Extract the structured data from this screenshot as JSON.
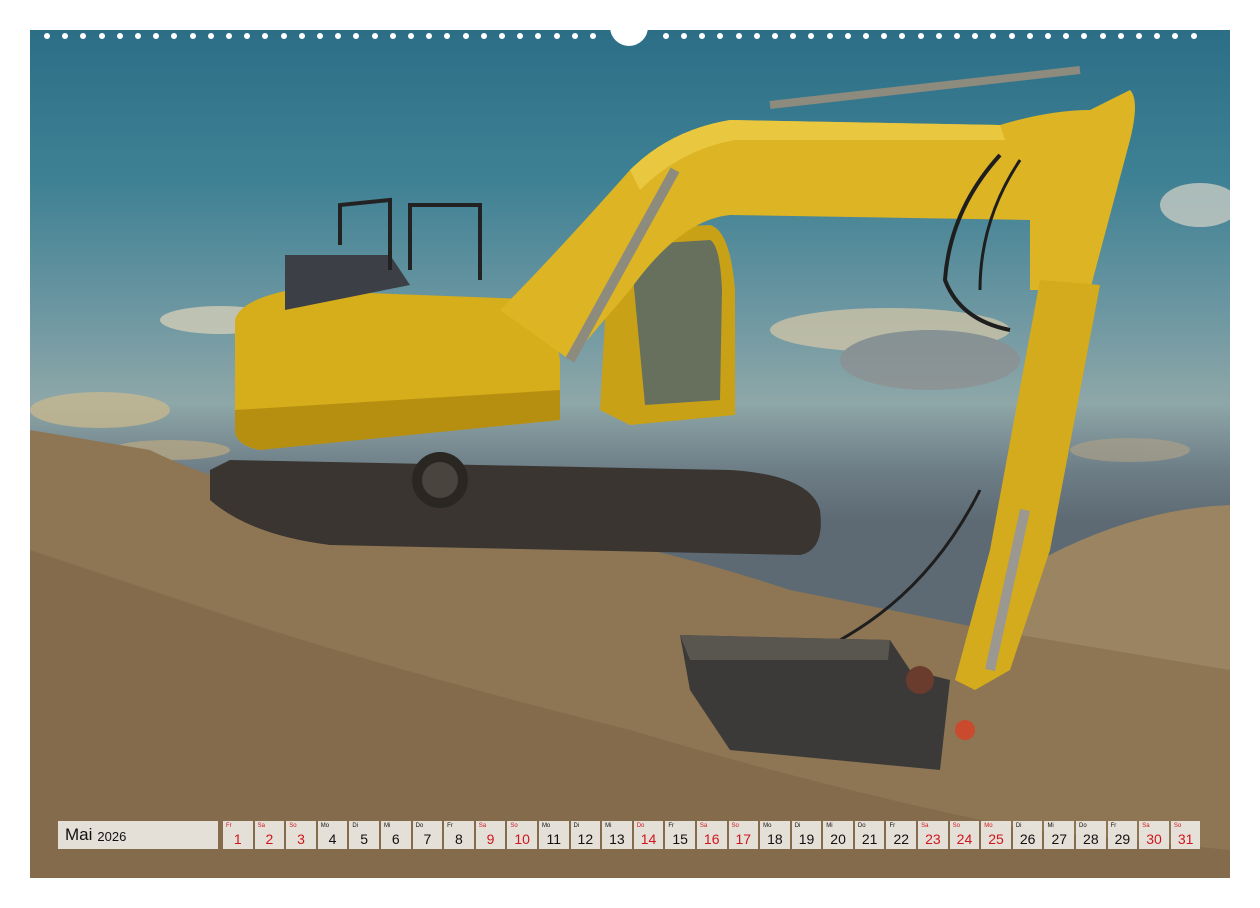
{
  "calendar": {
    "month": "Mai",
    "year": "2026",
    "days": [
      {
        "wd": "Fr",
        "num": "1",
        "red": true
      },
      {
        "wd": "Sa",
        "num": "2",
        "red": true
      },
      {
        "wd": "So",
        "num": "3",
        "red": true
      },
      {
        "wd": "Mo",
        "num": "4",
        "red": false
      },
      {
        "wd": "Di",
        "num": "5",
        "red": false
      },
      {
        "wd": "Mi",
        "num": "6",
        "red": false
      },
      {
        "wd": "Do",
        "num": "7",
        "red": false
      },
      {
        "wd": "Fr",
        "num": "8",
        "red": false
      },
      {
        "wd": "Sa",
        "num": "9",
        "red": true
      },
      {
        "wd": "So",
        "num": "10",
        "red": true
      },
      {
        "wd": "Mo",
        "num": "11",
        "red": false
      },
      {
        "wd": "Di",
        "num": "12",
        "red": false
      },
      {
        "wd": "Mi",
        "num": "13",
        "red": false
      },
      {
        "wd": "Do",
        "num": "14",
        "red": true
      },
      {
        "wd": "Fr",
        "num": "15",
        "red": false
      },
      {
        "wd": "Sa",
        "num": "16",
        "red": true
      },
      {
        "wd": "So",
        "num": "17",
        "red": true
      },
      {
        "wd": "Mo",
        "num": "18",
        "red": false
      },
      {
        "wd": "Di",
        "num": "19",
        "red": false
      },
      {
        "wd": "Mi",
        "num": "20",
        "red": false
      },
      {
        "wd": "Do",
        "num": "21",
        "red": false
      },
      {
        "wd": "Fr",
        "num": "22",
        "red": false
      },
      {
        "wd": "Sa",
        "num": "23",
        "red": true
      },
      {
        "wd": "So",
        "num": "24",
        "red": true
      },
      {
        "wd": "Mo",
        "num": "25",
        "red": true
      },
      {
        "wd": "Di",
        "num": "26",
        "red": false
      },
      {
        "wd": "Mi",
        "num": "27",
        "red": false
      },
      {
        "wd": "Do",
        "num": "28",
        "red": false
      },
      {
        "wd": "Fr",
        "num": "29",
        "red": false
      },
      {
        "wd": "Sa",
        "num": "30",
        "red": true
      },
      {
        "wd": "So",
        "num": "31",
        "red": true
      }
    ]
  },
  "colors": {
    "holiday_red": "#d0161d",
    "machine_yellow": "#d9b21c",
    "soil": "#8a7150"
  }
}
